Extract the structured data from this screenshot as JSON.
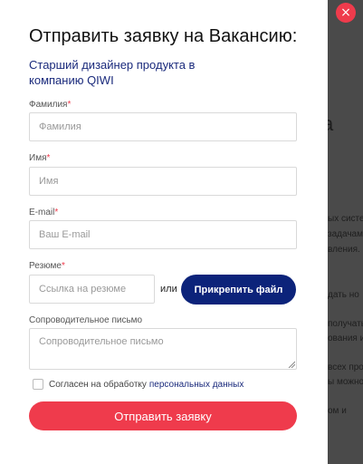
{
  "background": {
    "heading_fragment": "а",
    "text_fragments": [
      "ых систем",
      "задачами",
      "вления.",
      "дать но",
      "получать",
      "ования и",
      "всех прод",
      "ы можно",
      "ом и"
    ]
  },
  "close_button": {
    "label": "×"
  },
  "modal": {
    "title": "Отправить заявку на Вакансию:",
    "subtitle": "Старший дизайнер продукта в компанию QIWI",
    "fields": {
      "last_name": {
        "label": "Фамилия",
        "required": "*",
        "placeholder": "Фамилия"
      },
      "first_name": {
        "label": "Имя",
        "required": "*",
        "placeholder": "Имя"
      },
      "email": {
        "label": "E-mail",
        "required": "*",
        "placeholder": "Ваш E-mail"
      },
      "resume": {
        "label": "Резюме",
        "required": "*",
        "placeholder": "Ссылка на резюме",
        "or_text": "или",
        "attach_label": "Прикрепить файл"
      },
      "cover_letter": {
        "label": "Сопроводительное письмо",
        "placeholder": "Сопроводительное письмо"
      }
    },
    "consent": {
      "text": "Согласен на обработку",
      "link": "персональных данных",
      "checked": false
    },
    "submit_label": "Отправить заявку"
  },
  "colors": {
    "accent": "#ef3b4c",
    "primary": "#0c237a",
    "link": "#1a2a7c"
  }
}
